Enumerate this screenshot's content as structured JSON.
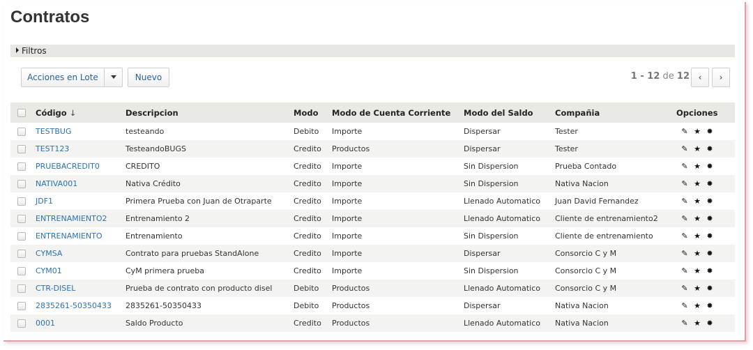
{
  "page": {
    "title": "Contratos",
    "filters_label": "Filtros"
  },
  "toolbar": {
    "batch_label": "Acciones en Lote",
    "new_label": "Nuevo"
  },
  "pager": {
    "range_start": "1",
    "range_sep": " - ",
    "range_end": "12",
    "of_label": " de ",
    "total": "12",
    "prev_glyph": "‹",
    "next_glyph": "›"
  },
  "table": {
    "headers": {
      "code": "Código",
      "sort_indicator": "↓",
      "description": "Descripcion",
      "mode": "Modo",
      "account_mode": "Modo de Cuenta Corriente",
      "balance_mode": "Modo del Saldo",
      "company": "Compañia",
      "options": "Opciones"
    },
    "rows": [
      {
        "code": "TESTBUG",
        "description": "testeando",
        "mode": "Debito",
        "account_mode": "Importe",
        "balance_mode": "Dispersar",
        "company": "Tester"
      },
      {
        "code": "TEST123",
        "description": "TesteandoBUGS",
        "mode": "Credito",
        "account_mode": "Productos",
        "balance_mode": "Dispersar",
        "company": "Tester"
      },
      {
        "code": "PRUEBACREDIT0",
        "description": "CREDITO",
        "mode": "Credito",
        "account_mode": "Importe",
        "balance_mode": "Sin Dispersion",
        "company": "Prueba Contado"
      },
      {
        "code": "NATIVA001",
        "description": "Nativa Crédito",
        "mode": "Credito",
        "account_mode": "Importe",
        "balance_mode": "Sin Dispersion",
        "company": "Nativa Nacion"
      },
      {
        "code": "JDF1",
        "description": "Primera Prueba con Juan de Otraparte",
        "mode": "Credito",
        "account_mode": "Importe",
        "balance_mode": "Llenado Automatico",
        "company": "Juan David Fernandez"
      },
      {
        "code": "ENTRENAMIENTO2",
        "description": "Entrenamiento 2",
        "mode": "Credito",
        "account_mode": "Importe",
        "balance_mode": "Llenado Automatico",
        "company": "Cliente de entrenamiento2"
      },
      {
        "code": "ENTRENAMIENTO",
        "description": "Entrenamiento",
        "mode": "Credito",
        "account_mode": "Importe",
        "balance_mode": "Sin Dispersion",
        "company": "Cliente de entrenamiento"
      },
      {
        "code": "CYMSA",
        "description": "Contrato para pruebas StandAlone",
        "mode": "Credito",
        "account_mode": "Importe",
        "balance_mode": "Dispersar",
        "company": "Consorcio C y M"
      },
      {
        "code": "CYM01",
        "description": "CyM primera prueba",
        "mode": "Credito",
        "account_mode": "Importe",
        "balance_mode": "Sin Dispersion",
        "company": "Consorcio C y M"
      },
      {
        "code": "CTR-DISEL",
        "description": "Prueba de contrato con producto disel",
        "mode": "Debito",
        "account_mode": "Productos",
        "balance_mode": "Llenado Automatico",
        "company": "Consorcio C y M"
      },
      {
        "code": "2835261-50350433",
        "description": "2835261-50350433",
        "mode": "Debito",
        "account_mode": "Productos",
        "balance_mode": "Dispersar",
        "company": "Nativa Nacion"
      },
      {
        "code": "0001",
        "description": "Saldo Producto",
        "mode": "Credito",
        "account_mode": "Productos",
        "balance_mode": "Llenado Automatico",
        "company": "Nativa Nacion"
      }
    ],
    "option_icons": {
      "edit": "✎",
      "favorite": "★",
      "settings": "✹"
    }
  }
}
